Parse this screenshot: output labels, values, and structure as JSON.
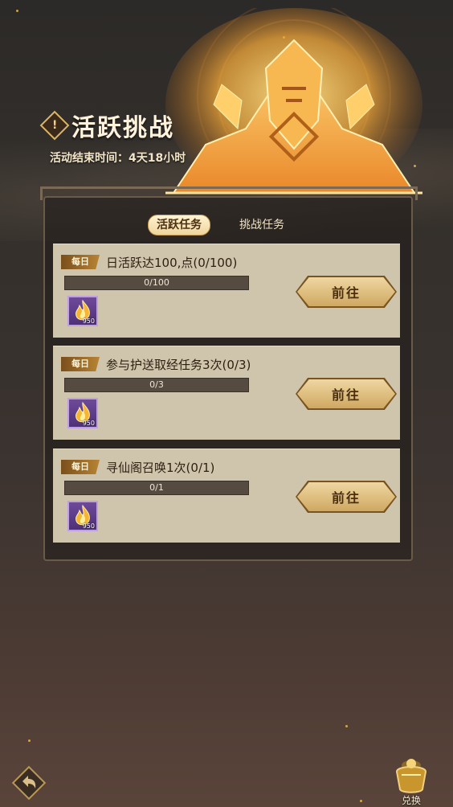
{
  "header": {
    "title": "活跃挑战",
    "alert_glyph": "!",
    "end_time": "活动结束时间：4天18小时"
  },
  "tabs": [
    {
      "label": "活跃任务",
      "active": true
    },
    {
      "label": "挑战任务",
      "active": false
    }
  ],
  "tasks": [
    {
      "badge": "每日",
      "text": "日活跃达100,点(0/100)",
      "progress_text": "0/100",
      "progress": 0,
      "reward_count": "950",
      "button": "前往"
    },
    {
      "badge": "每日",
      "text": "参与护送取经任务3次(0/3)",
      "progress_text": "0/3",
      "progress": 0,
      "reward_count": "950",
      "button": "前往"
    },
    {
      "badge": "每日",
      "text": "寻仙阁召唤1次(0/1)",
      "progress_text": "0/1",
      "progress": 0,
      "reward_count": "950",
      "button": "前往"
    }
  ],
  "footer": {
    "exchange_label": "兑换",
    "back_icon": "back-arrow-icon",
    "exchange_icon": "treasure-pot-icon"
  },
  "colors": {
    "accent": "#e7b550",
    "card_bg": "#cfc5ad",
    "reward_bg": "#5e3c88"
  }
}
